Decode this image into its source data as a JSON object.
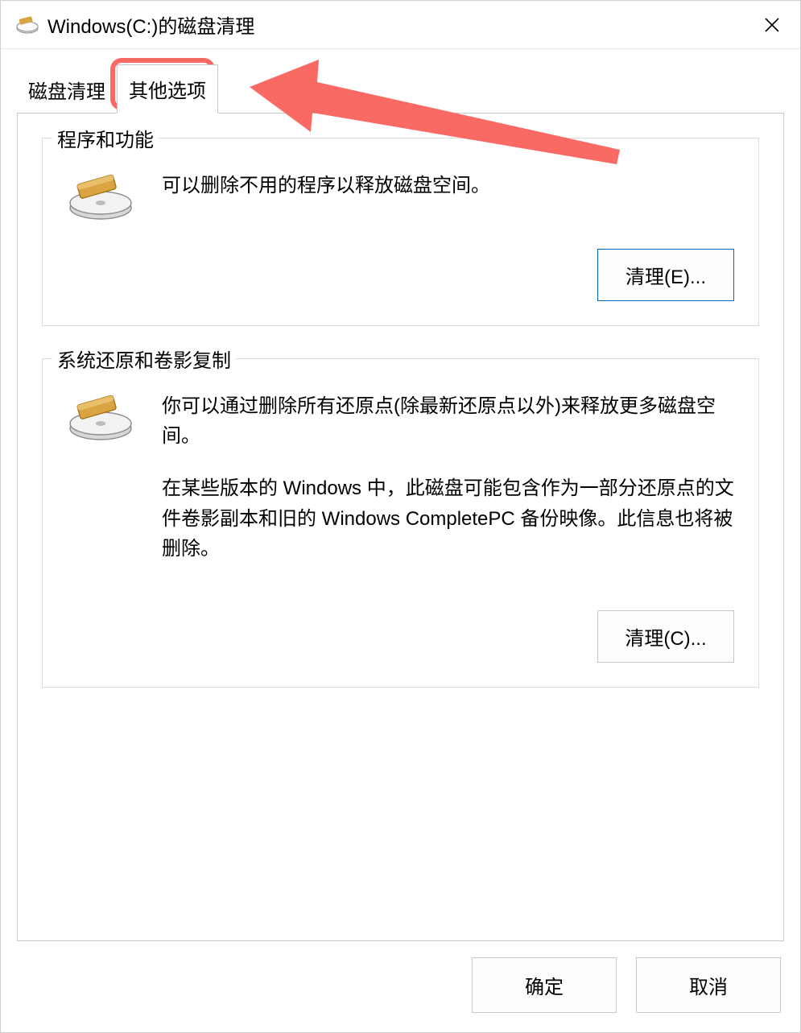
{
  "window": {
    "title": "Windows(C:)的磁盘清理"
  },
  "tabs": {
    "cleanup": "磁盘清理",
    "other": "其他选项"
  },
  "groups": {
    "programs": {
      "title": "程序和功能",
      "desc": "可以删除不用的程序以释放磁盘空间。",
      "button": "清理(E)..."
    },
    "restore": {
      "title": "系统还原和卷影复制",
      "desc1": "你可以通过删除所有还原点(除最新还原点以外)来释放更多磁盘空间。",
      "desc2": "在某些版本的 Windows 中，此磁盘可能包含作为一部分还原点的文件卷影副本和旧的 Windows CompletePC 备份映像。此信息也将被删除。",
      "button": "清理(C)..."
    }
  },
  "footer": {
    "ok": "确定",
    "cancel": "取消"
  },
  "annotation": {
    "color": "#f86a63"
  }
}
